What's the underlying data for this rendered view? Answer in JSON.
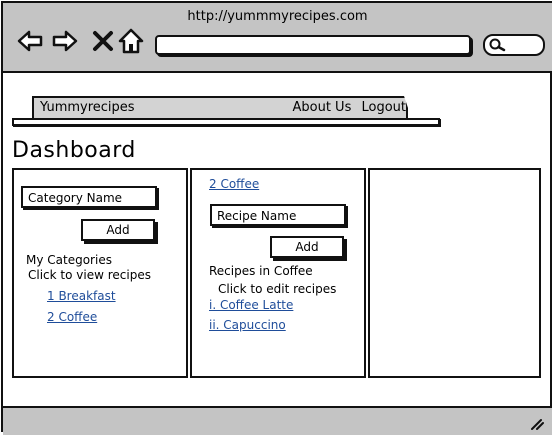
{
  "browser": {
    "url": "http://yummmyrecipes.com",
    "icons": [
      "back-icon",
      "forward-icon",
      "close-icon",
      "home-icon",
      "search-icon"
    ]
  },
  "nav": {
    "brand": "Yummyrecipes",
    "about": "About Us",
    "logout": "Logout"
  },
  "page": {
    "title": "Dashboard"
  },
  "categories_panel": {
    "input_placeholder": "Category Name",
    "add_label": "Add",
    "heading": "My Categories",
    "hint": "Click to view recipes",
    "items": [
      "1 Breakfast",
      "2 Coffee"
    ]
  },
  "recipes_panel": {
    "selected_category": "2 Coffee",
    "input_placeholder": "Recipe Name",
    "add_label": "Add",
    "heading": "Recipes in Coffee",
    "hint": "Click to edit recipes",
    "items": [
      "i. Coffee Latte",
      "ii. Capuccino"
    ]
  }
}
